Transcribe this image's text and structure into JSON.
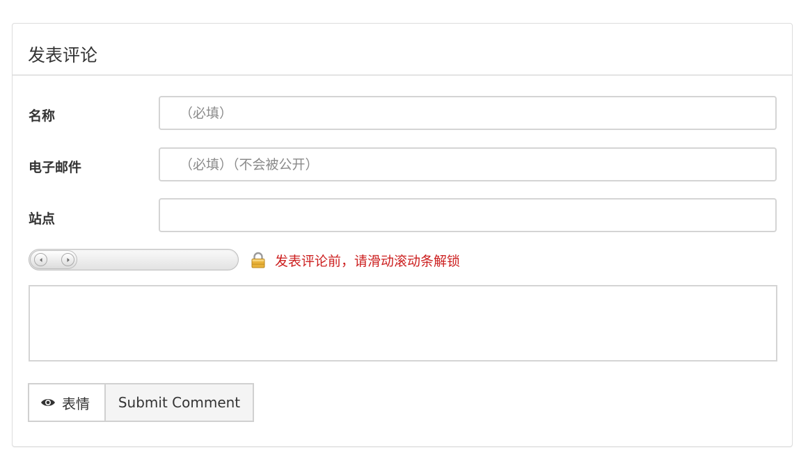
{
  "panel": {
    "title": "发表评论"
  },
  "form": {
    "name": {
      "label": "名称",
      "placeholder": "（必填）",
      "value": ""
    },
    "email": {
      "label": "电子邮件",
      "placeholder": "（必填）（不会被公开）",
      "value": ""
    },
    "site": {
      "label": "站点",
      "placeholder": "",
      "value": ""
    },
    "comment": {
      "value": ""
    }
  },
  "slider_lock": {
    "message": "发表评论前，请滑动滚动条解锁",
    "position": 0
  },
  "buttons": {
    "emoji_label": "表情",
    "submit_label": "Submit Comment"
  },
  "icons": {
    "lock": "lock-icon",
    "eye": "eye-icon",
    "slider_left": "arrow-left-icon",
    "slider_right": "arrow-right-icon"
  },
  "colors": {
    "lock_message": "#cc1f1f",
    "lock_body": "#e9b23a"
  }
}
